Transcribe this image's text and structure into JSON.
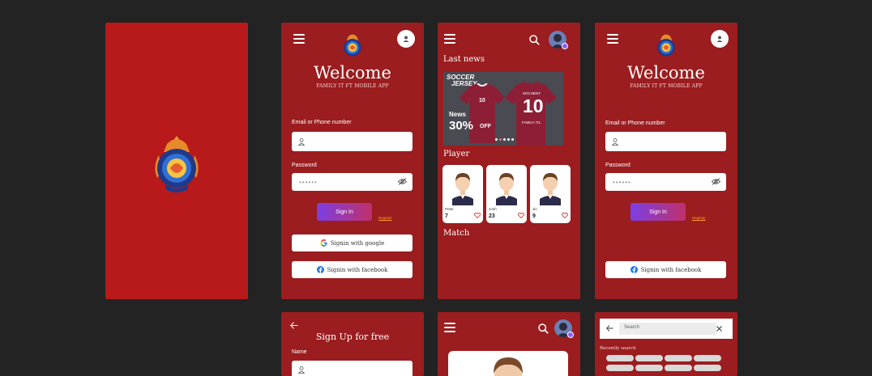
{
  "splash": {
    "logo_name": "family-it-logo"
  },
  "login": {
    "title": "Welcome",
    "subtitle": "FAMILY IT FT MOBILE APP",
    "email_label": "Email or Phone number",
    "password_label": "Password",
    "password_mask": "••••••",
    "signin_label": "Sign In",
    "register_label": "Register",
    "google_label": "Signin with google",
    "facebook_label": "Signin with facebook"
  },
  "home": {
    "last_news_title": "Last news",
    "banner": {
      "headline_top": "SOCCER",
      "headline_bottom": "JERSEY",
      "news": "News",
      "discount": "30%",
      "off": "OFF",
      "shirt_brand": "SOCHENT",
      "shirt_number": "10",
      "shirt_team": "FAMILY ITL"
    },
    "player_title": "Player",
    "players": [
      {
        "name": "Peter",
        "number": "7"
      },
      {
        "name": "Jonh",
        "number": "23"
      },
      {
        "name": "Jin",
        "number": "9"
      }
    ],
    "match_title": "Match"
  },
  "signup": {
    "title": "Sign Up for free",
    "name_label": "Name"
  },
  "search": {
    "placeholder": "Search",
    "recent_label": "Recently search"
  },
  "colors": {
    "frame": "#9b1d1f",
    "splash": "#b81a1b",
    "accent_start": "#7b3fe4",
    "accent_end": "#c1306a",
    "register": "#ff9a2e"
  }
}
